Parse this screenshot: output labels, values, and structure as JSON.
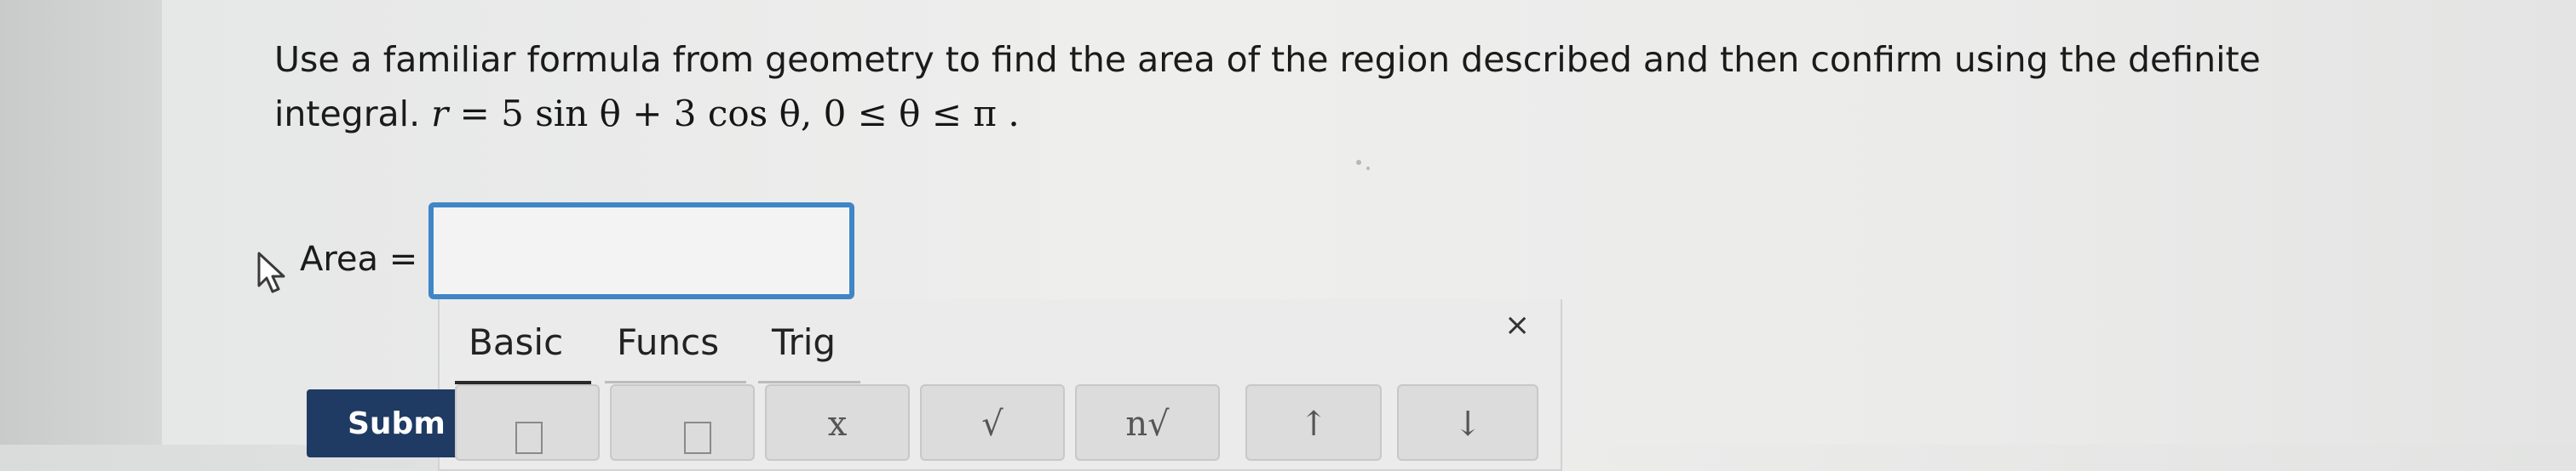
{
  "question": {
    "text_before": "Use a familiar formula from geometry to find the area of the region described and then confirm using the definite integral.",
    "r_var": "r",
    "equals": "=",
    "formula_rhs": "5 sin θ + 3 cos θ, 0 ≤ θ ≤ π",
    "end_punct": "."
  },
  "answer": {
    "label": "Area =",
    "value": ""
  },
  "keypad": {
    "tabs": [
      {
        "label": "Basic",
        "active": true
      },
      {
        "label": "Funcs",
        "active": false
      },
      {
        "label": "Trig",
        "active": false
      }
    ],
    "close_label": "×",
    "keys": [
      "",
      "",
      "x",
      "√",
      "n√",
      "↑",
      "↓"
    ]
  },
  "submit": {
    "label": "Subm"
  }
}
